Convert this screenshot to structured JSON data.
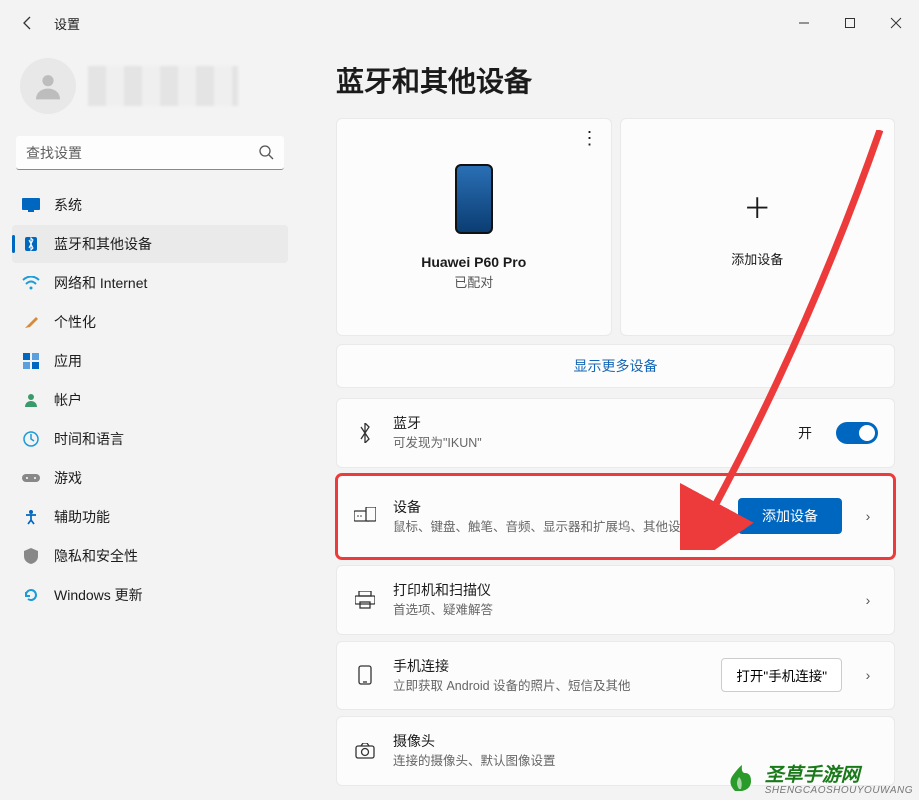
{
  "titlebar": {
    "app": "设置"
  },
  "search": {
    "placeholder": "查找设置"
  },
  "nav": {
    "items": [
      {
        "label": "系统"
      },
      {
        "label": "蓝牙和其他设备"
      },
      {
        "label": "网络和 Internet"
      },
      {
        "label": "个性化"
      },
      {
        "label": "应用"
      },
      {
        "label": "帐户"
      },
      {
        "label": "时间和语言"
      },
      {
        "label": "游戏"
      },
      {
        "label": "辅助功能"
      },
      {
        "label": "隐私和安全性"
      },
      {
        "label": "Windows 更新"
      }
    ]
  },
  "page": {
    "title": "蓝牙和其他设备"
  },
  "cards": {
    "device": {
      "name": "Huawei P60 Pro",
      "status": "已配对"
    },
    "add": {
      "label": "添加设备"
    }
  },
  "showMore": "显示更多设备",
  "bluetoothRow": {
    "title": "蓝牙",
    "sub": "可发现为\"IKUN\"",
    "stateLabel": "开"
  },
  "devicesRow": {
    "title": "设备",
    "sub": "鼠标、键盘、触笔、音频、显示器和扩展坞、其他设备",
    "button": "添加设备"
  },
  "printersRow": {
    "title": "打印机和扫描仪",
    "sub": "首选项、疑难解答"
  },
  "phoneRow": {
    "title": "手机连接",
    "sub": "立即获取 Android 设备的照片、短信及其他",
    "button": "打开\"手机连接\""
  },
  "cameraRow": {
    "title": "摄像头",
    "sub": "连接的摄像头、默认图像设置"
  },
  "watermark": {
    "name": "圣草手游网",
    "url": "SHENGCAOSHOUYOUWANG"
  }
}
